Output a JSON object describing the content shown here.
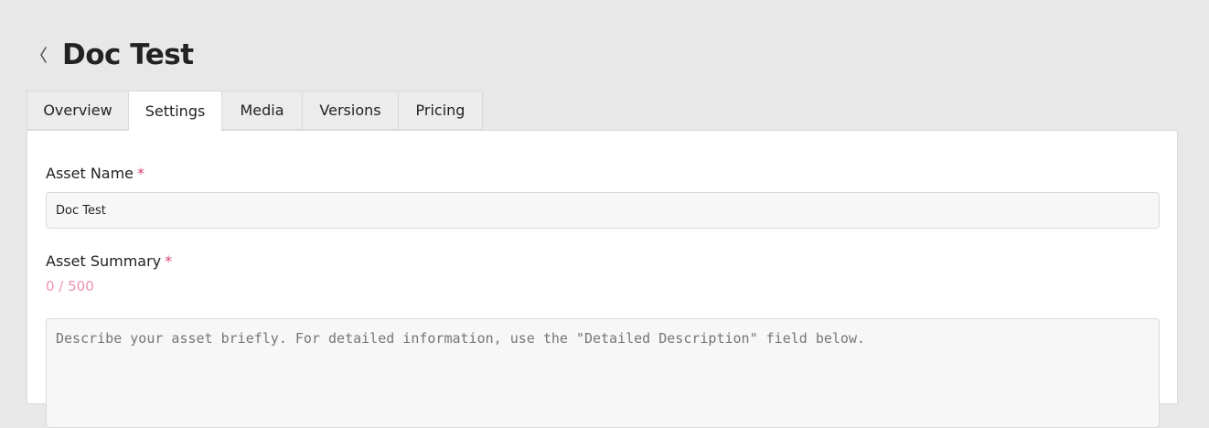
{
  "header": {
    "back_icon": "chevron-left-icon",
    "title": "Doc Test"
  },
  "tabs": [
    {
      "label": "Overview",
      "active": false
    },
    {
      "label": "Settings",
      "active": true
    },
    {
      "label": "Media",
      "active": false
    },
    {
      "label": "Versions",
      "active": false
    },
    {
      "label": "Pricing",
      "active": false
    }
  ],
  "form": {
    "asset_name": {
      "label": "Asset Name",
      "required_mark": "*",
      "value": "Doc Test"
    },
    "asset_summary": {
      "label": "Asset Summary",
      "required_mark": "*",
      "counter": "0 / 500",
      "value": "",
      "placeholder": "Describe your asset briefly. For detailed information, use the \"Detailed Description\" field below."
    }
  },
  "colors": {
    "background": "#e8e8e8",
    "required": "#d9466f",
    "counter": "#ef93b2"
  }
}
